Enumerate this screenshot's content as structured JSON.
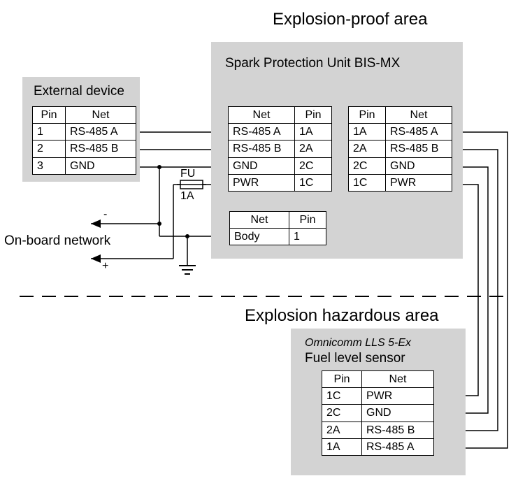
{
  "areas": {
    "explosion_proof": "Explosion-proof area",
    "hazardous": "Explosion hazardous area"
  },
  "external_device": {
    "title": "External device",
    "headers": {
      "pin": "Pin",
      "net": "Net"
    },
    "rows": [
      {
        "pin": "1",
        "net": "RS-485 A"
      },
      {
        "pin": "2",
        "net": "RS-485 B"
      },
      {
        "pin": "3",
        "net": "GND"
      }
    ]
  },
  "spark_unit": {
    "title": "Spark Protection Unit BIS-MX",
    "left": {
      "headers": {
        "net": "Net",
        "pin": "Pin"
      },
      "rows": [
        {
          "net": "RS-485 A",
          "pin": "1A"
        },
        {
          "net": "RS-485 B",
          "pin": "2A"
        },
        {
          "net": "GND",
          "pin": "2C"
        },
        {
          "net": "PWR",
          "pin": "1C"
        }
      ]
    },
    "right": {
      "headers": {
        "pin": "Pin",
        "net": "Net"
      },
      "rows": [
        {
          "pin": "1A",
          "net": "RS-485 A"
        },
        {
          "pin": "2A",
          "net": "RS-485 B"
        },
        {
          "pin": "2C",
          "net": "GND"
        },
        {
          "pin": "1C",
          "net": "PWR"
        }
      ]
    },
    "body": {
      "headers": {
        "net": "Net",
        "pin": "Pin"
      },
      "rows": [
        {
          "net": "Body",
          "pin": "1"
        }
      ]
    }
  },
  "fuel_sensor": {
    "subtitle": "Omnicomm LLS 5-Ex",
    "title": "Fuel level sensor",
    "headers": {
      "pin": "Pin",
      "net": "Net"
    },
    "rows": [
      {
        "pin": "1C",
        "net": "PWR"
      },
      {
        "pin": "2C",
        "net": "GND"
      },
      {
        "pin": "2A",
        "net": "RS-485 B"
      },
      {
        "pin": "1A",
        "net": "RS-485 A"
      }
    ]
  },
  "labels": {
    "fuse": "FU",
    "fuse_rating": "1A",
    "onboard": "On-board network",
    "minus": "-",
    "plus": "+"
  }
}
